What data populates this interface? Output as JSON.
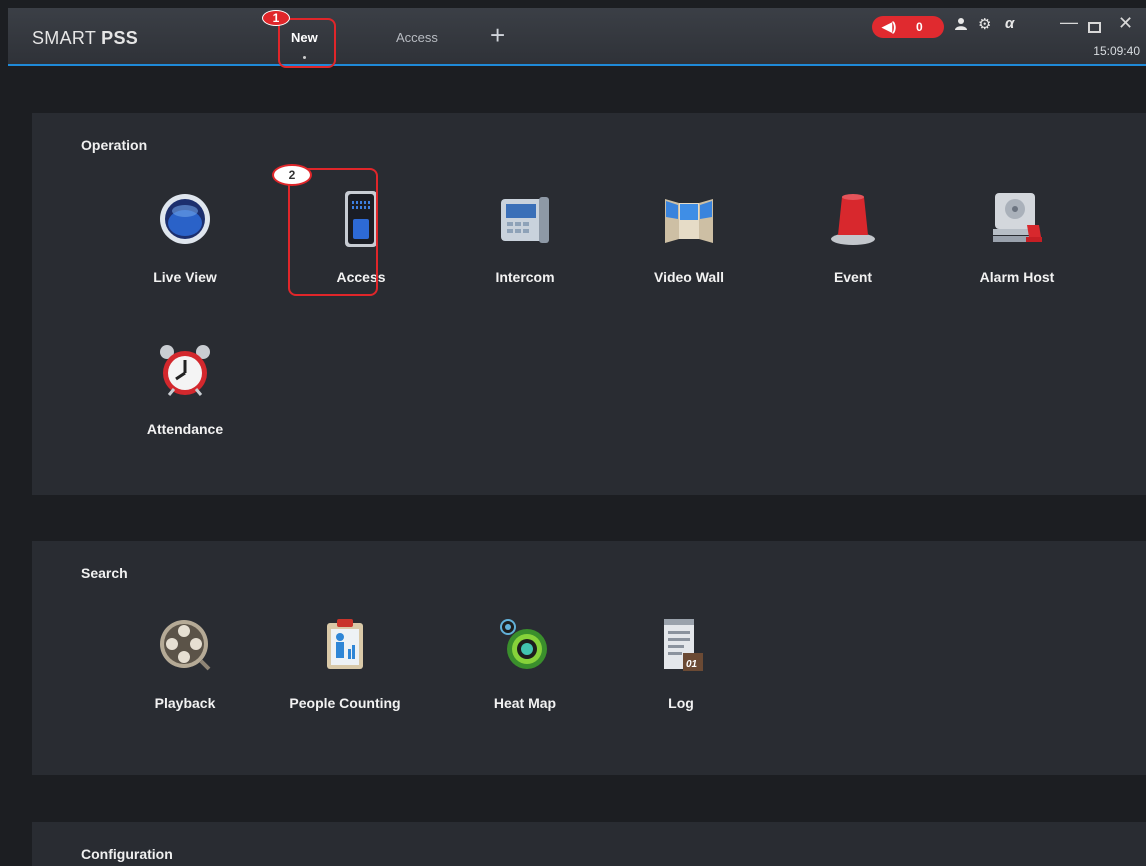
{
  "app": {
    "brand_light": "SMART ",
    "brand_bold": "PSS",
    "tabs": [
      {
        "label": "New",
        "active": true
      },
      {
        "label": "Access",
        "active": false
      }
    ],
    "add_tab_glyph": "+"
  },
  "toolbar": {
    "alarm_count": "0",
    "icons": [
      "speaker-icon",
      "user-icon",
      "gear-icon",
      "performance-icon"
    ],
    "clock": "15:09:40"
  },
  "annotations": [
    "1",
    "2"
  ],
  "sections": {
    "operation": {
      "title": "Operation",
      "items": [
        {
          "label": "Live View",
          "icon": "live-view-icon"
        },
        {
          "label": "Access",
          "icon": "access-icon"
        },
        {
          "label": "Intercom",
          "icon": "intercom-icon"
        },
        {
          "label": "Video Wall",
          "icon": "video-wall-icon"
        },
        {
          "label": "Event",
          "icon": "event-icon"
        },
        {
          "label": "Alarm Host",
          "icon": "alarm-host-icon"
        },
        {
          "label": "Attendance",
          "icon": "attendance-icon"
        }
      ]
    },
    "search": {
      "title": "Search",
      "items": [
        {
          "label": "Playback",
          "icon": "playback-icon"
        },
        {
          "label": "People Counting",
          "icon": "people-counting-icon"
        },
        {
          "label": "Heat Map",
          "icon": "heat-map-icon"
        },
        {
          "label": "Log",
          "icon": "log-icon"
        }
      ]
    },
    "configuration": {
      "title": "Configuration"
    }
  },
  "colors": {
    "accent": "#1f8ad8",
    "alert": "#e02a2f",
    "background": "#1c1e22",
    "panel": "#292c32"
  }
}
